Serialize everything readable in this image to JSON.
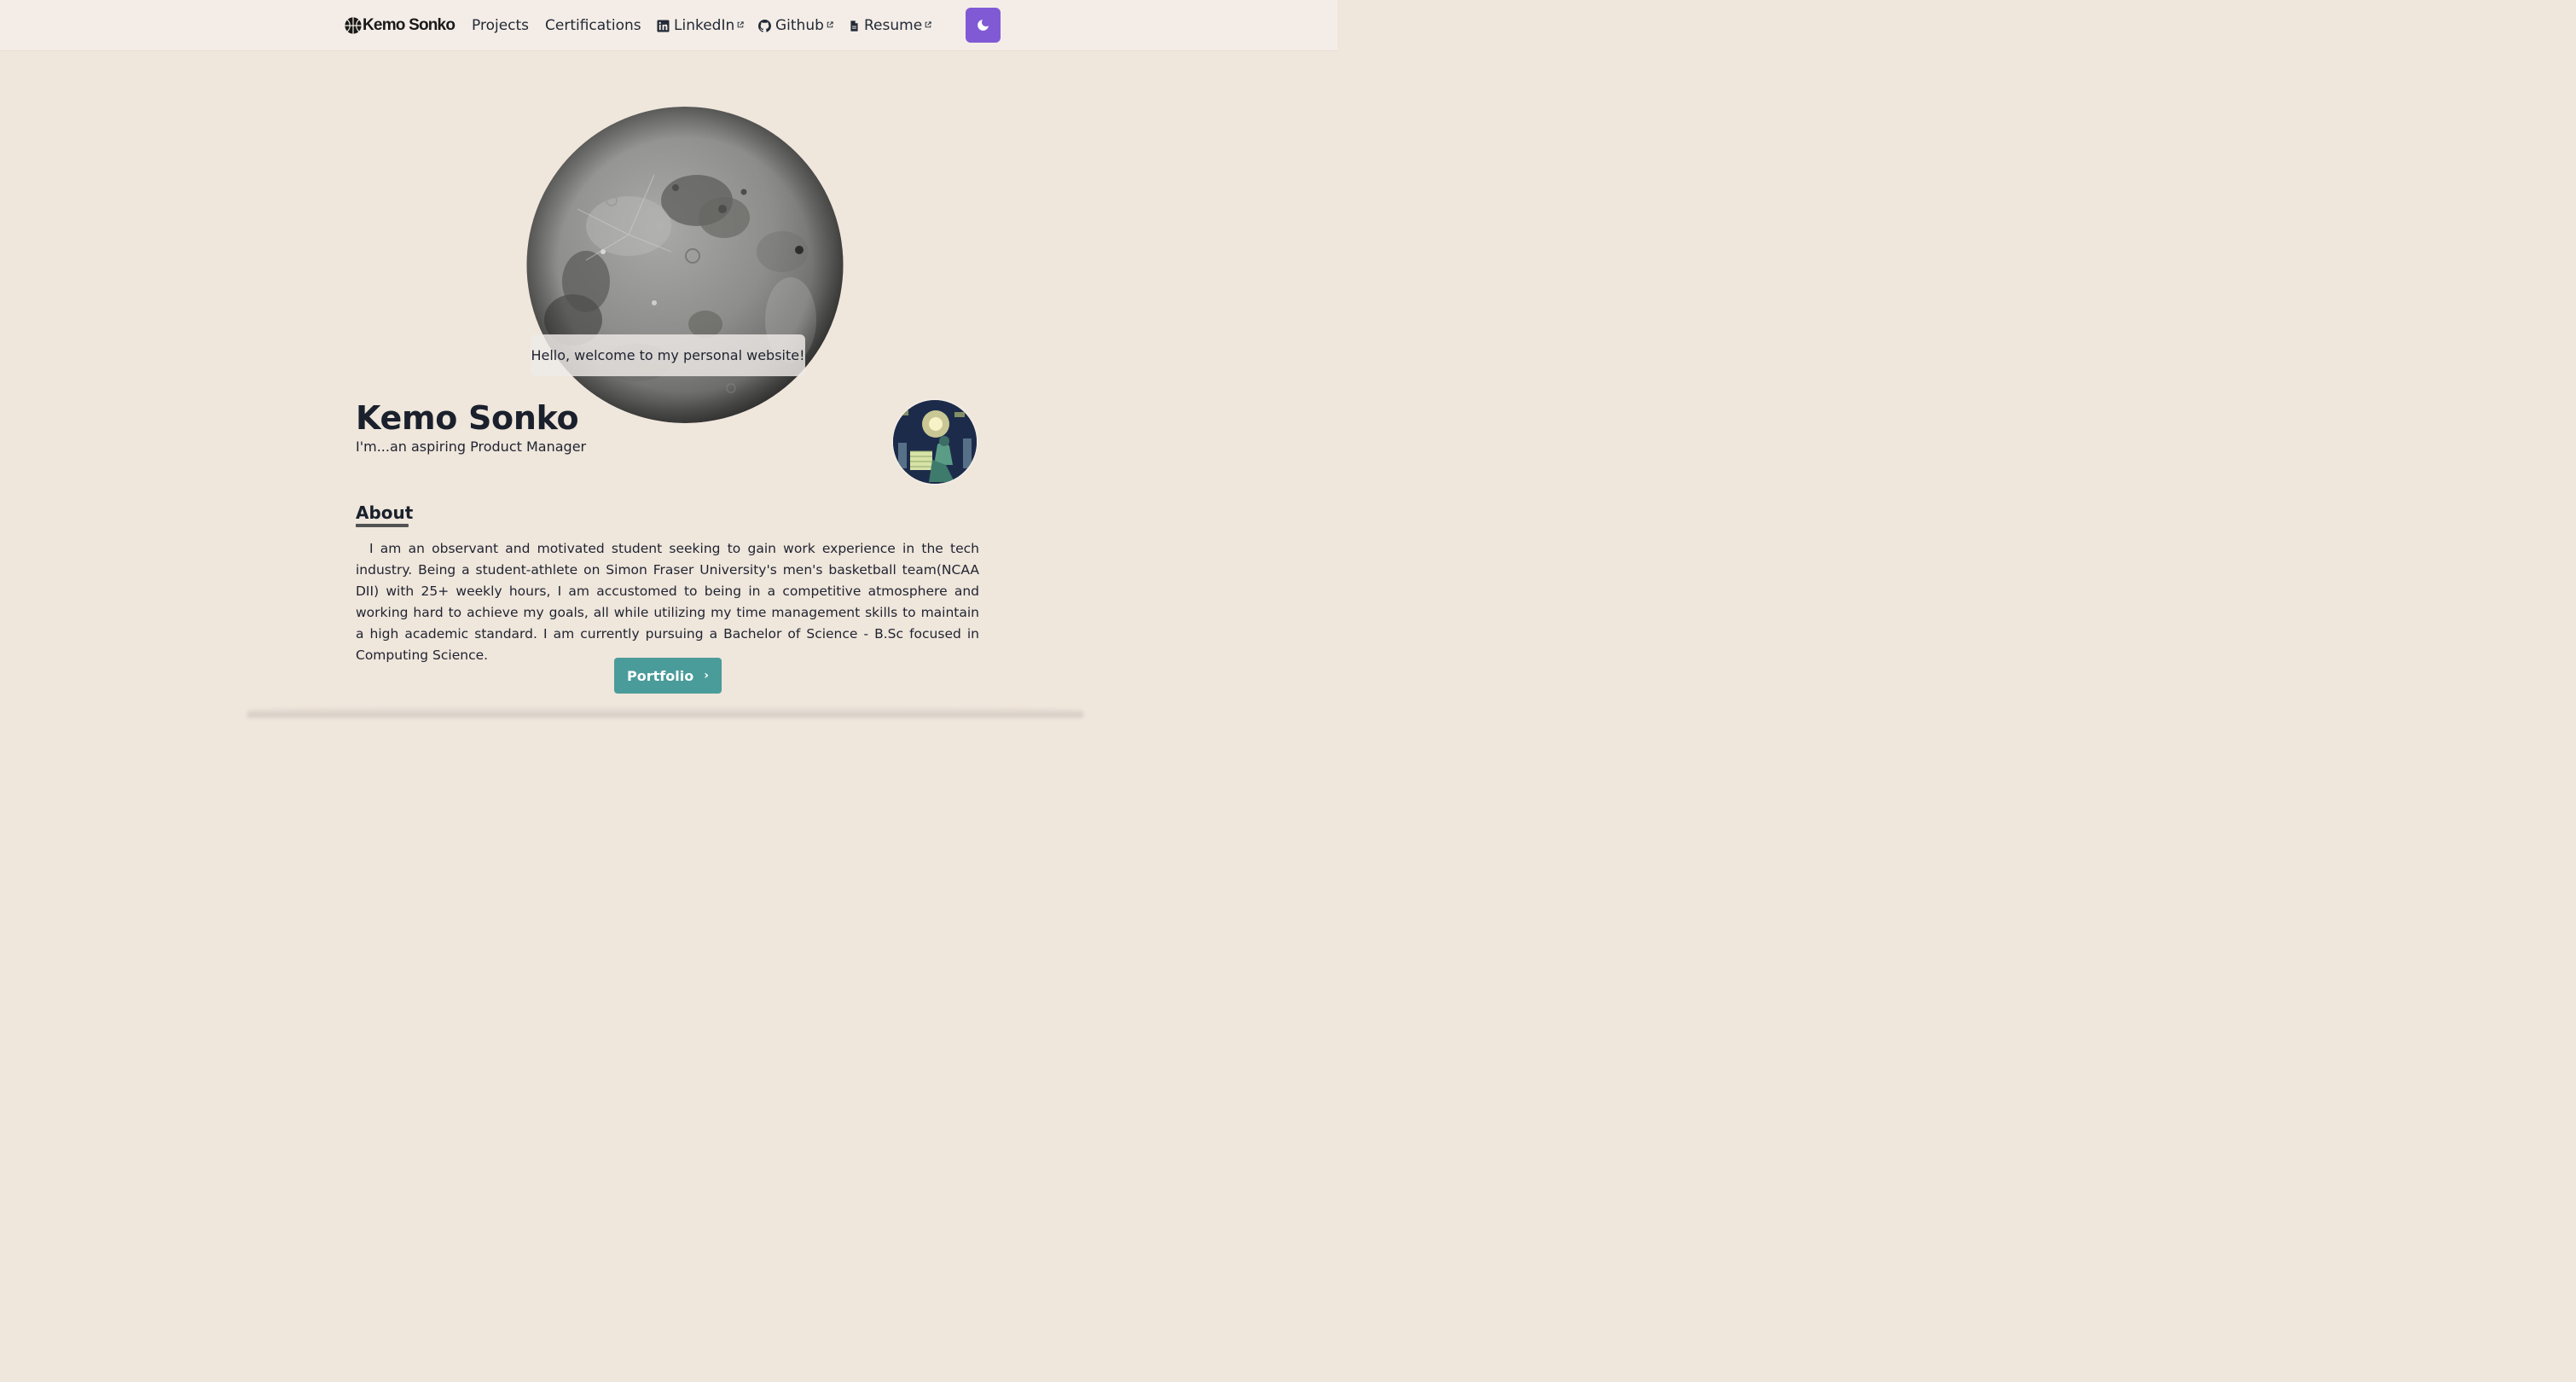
{
  "nav": {
    "brand": "Kemo Sonko",
    "links": [
      {
        "label": "Projects"
      },
      {
        "label": "Certifications"
      },
      {
        "label": "LinkedIn",
        "icon": "linkedin-icon",
        "external": true
      },
      {
        "label": "Github",
        "icon": "github-icon",
        "external": true
      },
      {
        "label": "Resume",
        "icon": "file-icon",
        "external": true
      }
    ],
    "theme_toggle_icon": "moon-icon",
    "theme_toggle_color": "#805ad5"
  },
  "hero": {
    "greeting": "Hello, welcome to my personal website!",
    "name": "Kemo Sonko",
    "tagline": "I'm...an aspiring Product Manager"
  },
  "about": {
    "heading": "About",
    "text": "I am an observant and motivated student seeking to gain work experience in the tech industry. Being a student-athlete on Simon Fraser University's men's basketball team(NCAA DII) with 25+ weekly hours, I am accustomed to being in a competitive atmosphere and working hard to achieve my goals, all while utilizing my time management skills to maintain a high academic standard. I am currently pursuing a Bachelor of Science - B.Sc focused in Computing Science."
  },
  "portfolio_button": {
    "label": "Portfolio",
    "icon": "chevron-right-icon",
    "color": "#4a9c9a"
  },
  "colors": {
    "background": "#efe6dc",
    "navbar": "#f4ede7",
    "text": "#1f2330"
  }
}
